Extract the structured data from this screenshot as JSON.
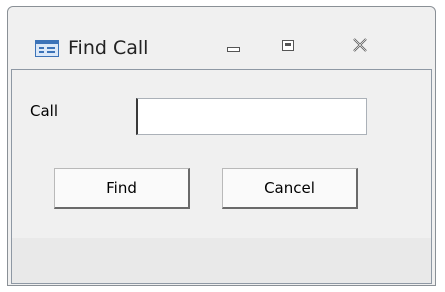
{
  "window": {
    "title": "Find Call",
    "icon": "form-icon",
    "controls": {
      "minimize": "minimize-icon",
      "maximize": "maximize-icon",
      "close": "close-icon"
    }
  },
  "form": {
    "call_label": "Call",
    "call_value": "",
    "find_label": "Find",
    "cancel_label": "Cancel"
  },
  "colors": {
    "window_background": "#f0f0f0",
    "input_background": "#ffffff",
    "icon_accent": "#3c73b8"
  }
}
